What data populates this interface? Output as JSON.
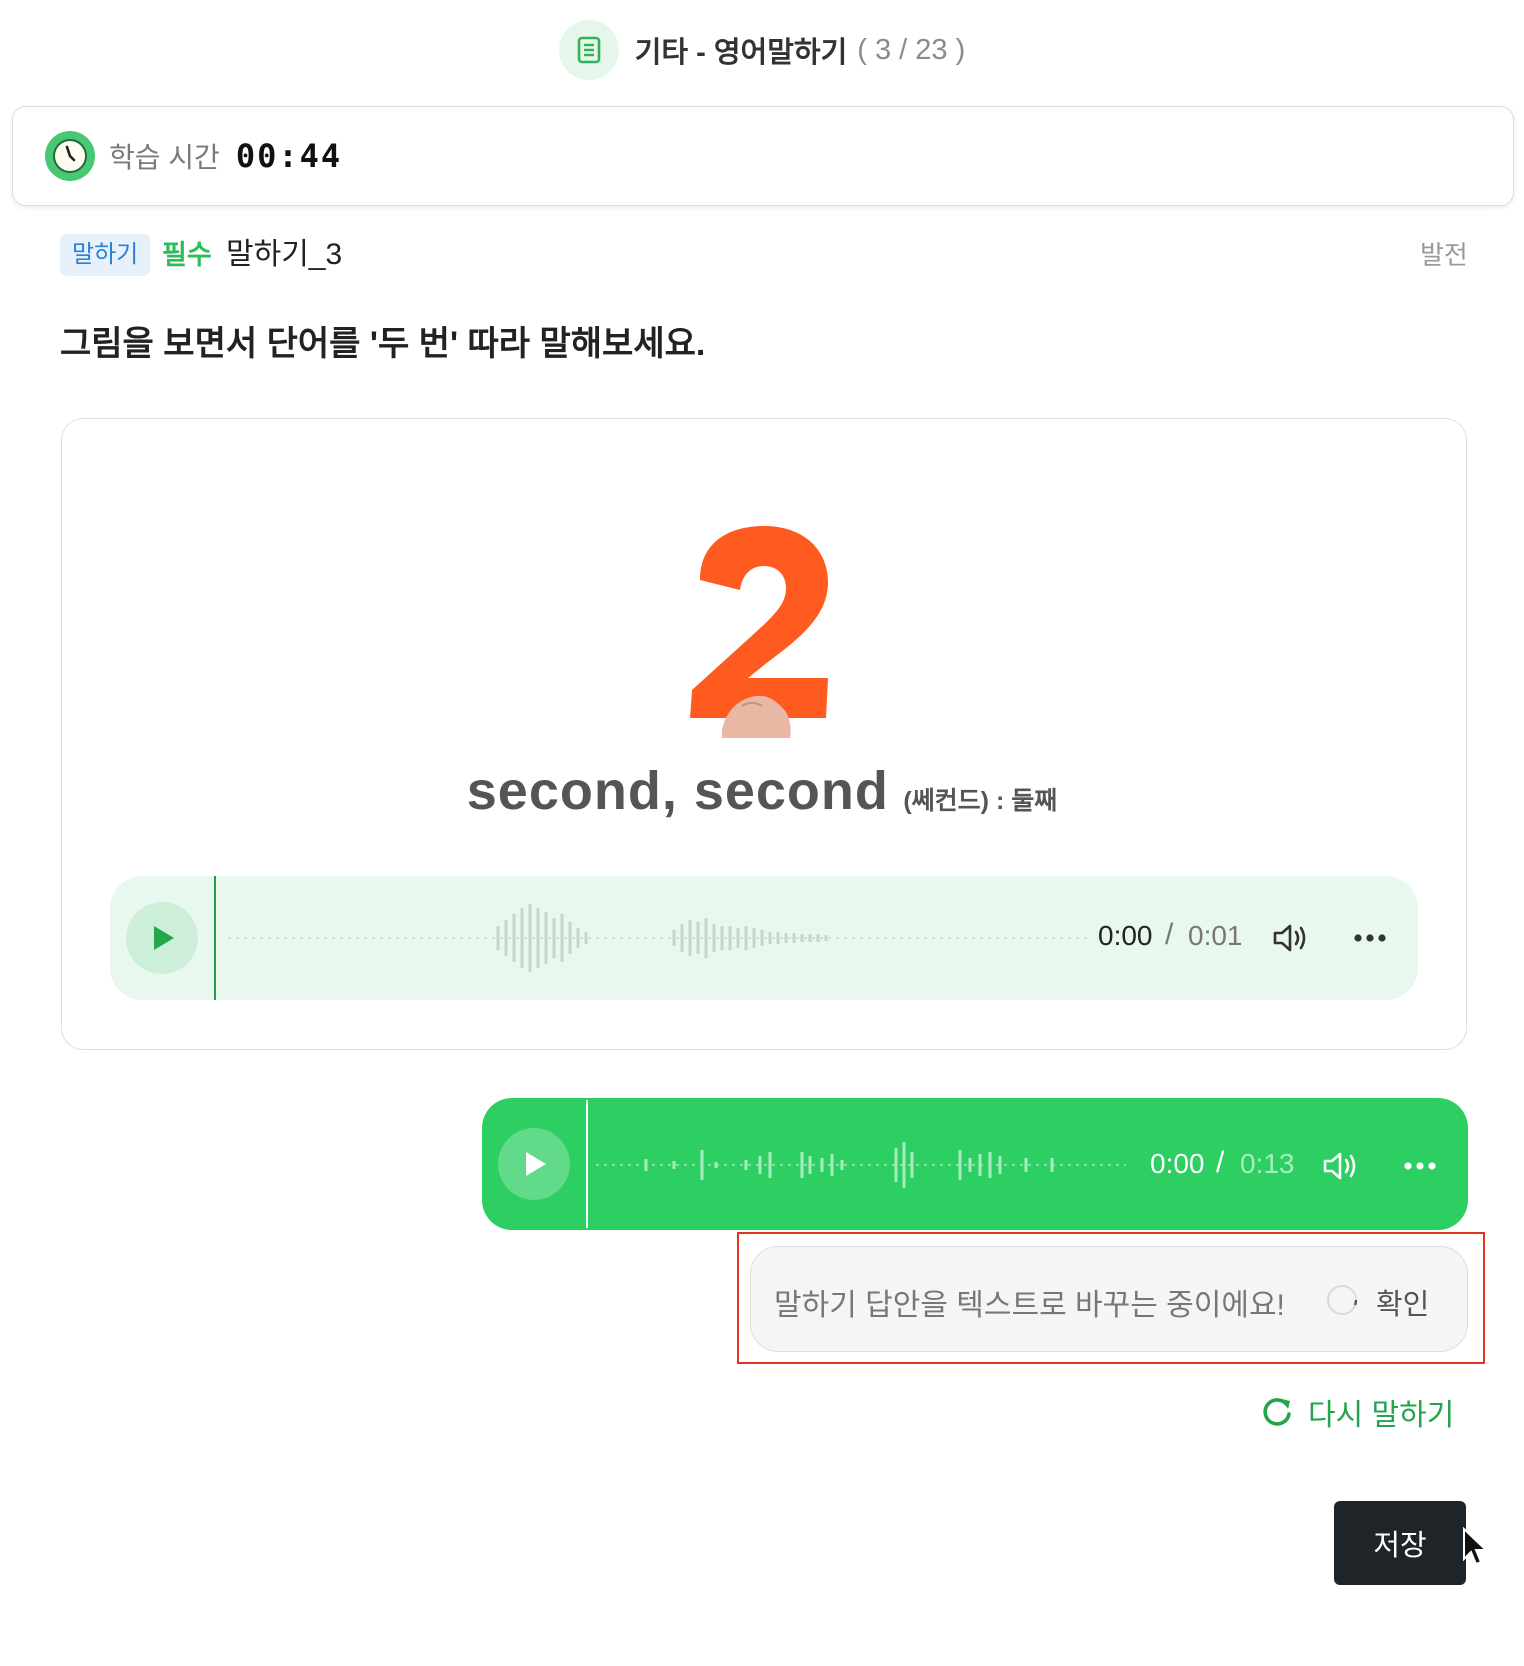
{
  "header": {
    "title": "기타 - 영어말하기",
    "progress": "( 3 / 23 )"
  },
  "timer": {
    "label": "학습 시간",
    "value": "00:44"
  },
  "question": {
    "type_tag": "말하기",
    "required_tag": "필수",
    "name": "말하기_3",
    "level": "발전",
    "instruction": "그림을 보면서 단어를 '두 번' 따라 말해보세요."
  },
  "card": {
    "word": "second, second",
    "word_hint": "(쎄컨드) : 둘째"
  },
  "prompt_audio": {
    "current": "0:00",
    "separator": "/",
    "duration": "0:01"
  },
  "answer_audio": {
    "current": "0:00",
    "separator": "/",
    "duration": "0:13"
  },
  "transcription": {
    "text": "말하기 답안을 텍스트로 바꾸는 중이에요!",
    "confirm_label": "확인"
  },
  "retry": {
    "label": "다시 말하기"
  },
  "save": {
    "label": "저장"
  },
  "colors": {
    "accent_green": "#2dcf62",
    "tag_blue": "#2b7fd6",
    "highlight_red": "#e2341e",
    "digit_orange": "#ff5a1f"
  }
}
